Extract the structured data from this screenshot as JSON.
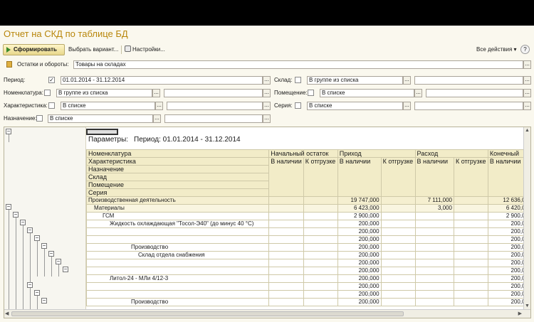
{
  "window": {
    "title": "Отчет на СКД по таблице БД"
  },
  "toolbar": {
    "generate_label": "Сформировать",
    "choose_variant_label": "Выбрать вариант...",
    "settings_label": "Настройки...",
    "all_actions_label": "Все действия",
    "help_label": "?"
  },
  "filters": {
    "scheme_label": "Остатки и обороты:",
    "scheme_value": "Товары на складах",
    "period_label": "Период:",
    "period_value": "01.01.2014 - 31.12.2014",
    "warehouse_label": "Склад:",
    "warehouse_value": "В группе из списка",
    "nomenclature_label": "Номенклатура:",
    "nomenclature_value": "В группе из списка",
    "room_label": "Помещение:",
    "room_value": "В списке",
    "characteristic_label": "Характеристика:",
    "characteristic_value": "В списке",
    "series_label": "Серия:",
    "series_value": "В списке",
    "purpose_label": "Назначение:",
    "purpose_value": "В списке",
    "dots": "..."
  },
  "report": {
    "params_label": "Параметры:",
    "params_value": "Период: 01.01.2014 - 31.12.2014",
    "headers": {
      "nomenclature": "Номенклатура",
      "characteristic": "Характеристика",
      "purpose": "Назначение",
      "warehouse": "Склад",
      "room": "Помещение",
      "series": "Серия",
      "opening": "Начальный остаток",
      "income": "Приход",
      "expense": "Расход",
      "closing": "Конечный",
      "in_stock": "В наличии",
      "to_ship": "К отгрузке"
    },
    "rows": [
      {
        "name": "Производственная деятельность",
        "opening_stock": "",
        "opening_ship": "",
        "income_stock": "19 747,000",
        "income_ship": "",
        "expense_stock": "7 111,000",
        "expense_ship": "",
        "closing_stock": "12 636,00"
      },
      {
        "name": "Материалы",
        "opening_stock": "",
        "opening_ship": "",
        "income_stock": "6 423,000",
        "income_ship": "",
        "expense_stock": "3,000",
        "expense_ship": "",
        "closing_stock": "6 420,00"
      },
      {
        "name": "ГСМ",
        "opening_stock": "",
        "opening_ship": "",
        "income_stock": "2 900,000",
        "income_ship": "",
        "expense_stock": "",
        "expense_ship": "",
        "closing_stock": "2 900,00"
      },
      {
        "name": "Жидкость охлаждающая \"Тосол-Э40\" (до минус 40 °С)",
        "opening_stock": "",
        "opening_ship": "",
        "income_stock": "200,000",
        "income_ship": "",
        "expense_stock": "",
        "expense_ship": "",
        "closing_stock": "200,00"
      },
      {
        "name": "",
        "opening_stock": "",
        "opening_ship": "",
        "income_stock": "200,000",
        "income_ship": "",
        "expense_stock": "",
        "expense_ship": "",
        "closing_stock": "200,00"
      },
      {
        "name": "",
        "opening_stock": "",
        "opening_ship": "",
        "income_stock": "200,000",
        "income_ship": "",
        "expense_stock": "",
        "expense_ship": "",
        "closing_stock": "200,00"
      },
      {
        "name": "Производство",
        "opening_stock": "",
        "opening_ship": "",
        "income_stock": "200,000",
        "income_ship": "",
        "expense_stock": "",
        "expense_ship": "",
        "closing_stock": "200,00"
      },
      {
        "name": "Склад отдела снабжения",
        "opening_stock": "",
        "opening_ship": "",
        "income_stock": "200,000",
        "income_ship": "",
        "expense_stock": "",
        "expense_ship": "",
        "closing_stock": "200,00"
      },
      {
        "name": "",
        "opening_stock": "",
        "opening_ship": "",
        "income_stock": "200,000",
        "income_ship": "",
        "expense_stock": "",
        "expense_ship": "",
        "closing_stock": "200,00"
      },
      {
        "name": "",
        "opening_stock": "",
        "opening_ship": "",
        "income_stock": "200,000",
        "income_ship": "",
        "expense_stock": "",
        "expense_ship": "",
        "closing_stock": "200,00"
      },
      {
        "name": "Литол-24 - МЛи 4/12-3",
        "opening_stock": "",
        "opening_ship": "",
        "income_stock": "200,000",
        "income_ship": "",
        "expense_stock": "",
        "expense_ship": "",
        "closing_stock": "200,00"
      },
      {
        "name": "",
        "opening_stock": "",
        "opening_ship": "",
        "income_stock": "200,000",
        "income_ship": "",
        "expense_stock": "",
        "expense_ship": "",
        "closing_stock": "200,00"
      },
      {
        "name": "",
        "opening_stock": "",
        "opening_ship": "",
        "income_stock": "200,000",
        "income_ship": "",
        "expense_stock": "",
        "expense_ship": "",
        "closing_stock": "200,00"
      },
      {
        "name": "Производство",
        "opening_stock": "",
        "opening_ship": "",
        "income_stock": "200,000",
        "income_ship": "",
        "expense_stock": "",
        "expense_ship": "",
        "closing_stock": "200,00"
      }
    ]
  }
}
